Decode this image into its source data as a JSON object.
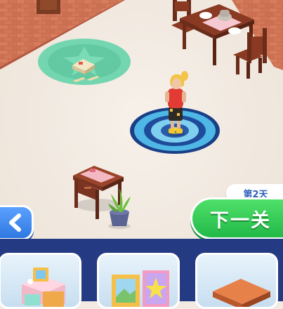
{
  "hud": {
    "day_label": "第2天",
    "next_label": "下一关",
    "back_icon": "chevron-left-icon"
  },
  "furniture_tray": {
    "items": [
      {
        "name": "vanity-desk"
      },
      {
        "name": "picture-frames"
      },
      {
        "name": "wooden-table"
      }
    ]
  },
  "colors": {
    "next_button": "#2cc74f",
    "back_button": "#3b86f0",
    "day_text": "#2b5fb8",
    "tray_background": "#243a82",
    "floor": "#f3ebe3",
    "brick_wall": "#c96b4e"
  }
}
